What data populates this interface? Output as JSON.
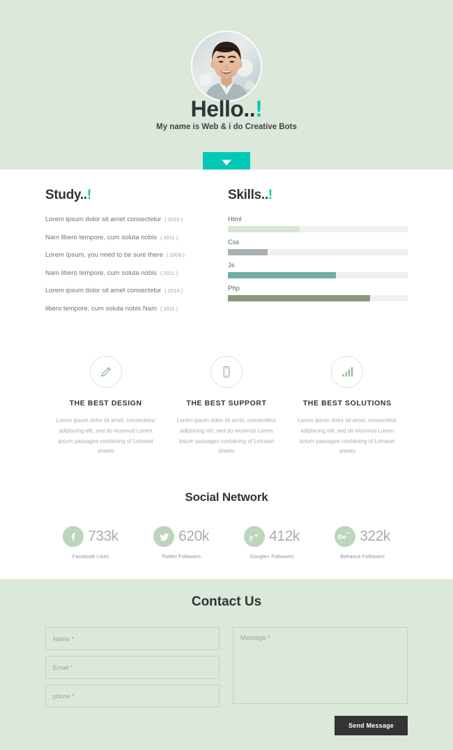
{
  "hero": {
    "avatar_icon": "user-avatar-photo",
    "greeting": "Hello..!",
    "greeting_base": "Hello..",
    "greeting_bang": "!",
    "tagline": "My name is Web & i do Creative Bots",
    "scroll_button_icon": "chevron-down-icon",
    "bg_color": "#dce8da",
    "accent_color": "#00c9b7"
  },
  "study": {
    "title_base": "Study..",
    "title_bang": "!",
    "items": [
      {
        "text": "Lorem ipsum dolor sit amet consectetur",
        "year": "( 2010 )"
      },
      {
        "text": "Nam libero tempore, cum soluta nobis",
        "year": "( 2011 )"
      },
      {
        "text": "Lorem Ipsum, you need to be sure there",
        "year": "( 2009 )"
      },
      {
        "text": "Nam libero tempore, cum soluta nobis",
        "year": "( 2011 )"
      },
      {
        "text": "Lorem ipsum dolor sit amet consectetur",
        "year": "( 2014 )"
      },
      {
        "text": "libero tempore, cum soluta nobis Nam",
        "year": "( 2011 )"
      }
    ]
  },
  "skills": {
    "title_base": "Skills..",
    "title_bang": "!",
    "items": [
      {
        "name": "Html",
        "percent": 40,
        "color": "#d8e6d4"
      },
      {
        "name": "Css",
        "percent": 22,
        "color": "#a8afb2"
      },
      {
        "name": "Js",
        "percent": 60,
        "color": "#6cafa4"
      },
      {
        "name": "Php",
        "percent": 79,
        "color": "#89997a"
      }
    ],
    "track_color": "#f0f1ef"
  },
  "services": [
    {
      "icon": "pencil-icon",
      "title": "THE BEST DESIGN",
      "text": "Lorem ipsum dolor sit amet, consectetur adipiscing elit, sed do eiusmod Lorem ipsum passages containing of Letraset sheets"
    },
    {
      "icon": "mobile-phone-icon",
      "title": "THE BEST SUPPORT",
      "text": "Lorem ipsum dolor sit amet, consectetur adipiscing elit, sed do eiusmod Lorem ipsum passages containing of Letraset sheets"
    },
    {
      "icon": "bar-chart-icon",
      "title": "THE BEST SOLUTIONS",
      "text": "Lorem ipsum dolor sit amet, consectetur adipiscing elit, sed do eiusmod Lorem ipsum passages containing of Letraset sheets"
    }
  ],
  "social": {
    "title": "Social Network",
    "circle_color": "#bdd5bb",
    "items": [
      {
        "icon": "facebook-icon",
        "glyph": "f",
        "count": "733k",
        "label": "Facebook Likes"
      },
      {
        "icon": "twitter-icon",
        "glyph": "",
        "count": "620k",
        "label": "Twitter Followers"
      },
      {
        "icon": "google-plus-icon",
        "glyph": "g+",
        "count": "412k",
        "label": "Google+ Followers"
      },
      {
        "icon": "behance-icon",
        "glyph": "Bē",
        "count": "322k",
        "label": "Behance Followers"
      }
    ]
  },
  "contact": {
    "title": "Contact Us",
    "name_placeholder": "Name *",
    "email_placeholder": "Email *",
    "phone_placeholder": "phone *",
    "message_placeholder": "Message *",
    "send_label": "Send Message",
    "bg_color": "#dce8da",
    "button_color": "#343434"
  }
}
